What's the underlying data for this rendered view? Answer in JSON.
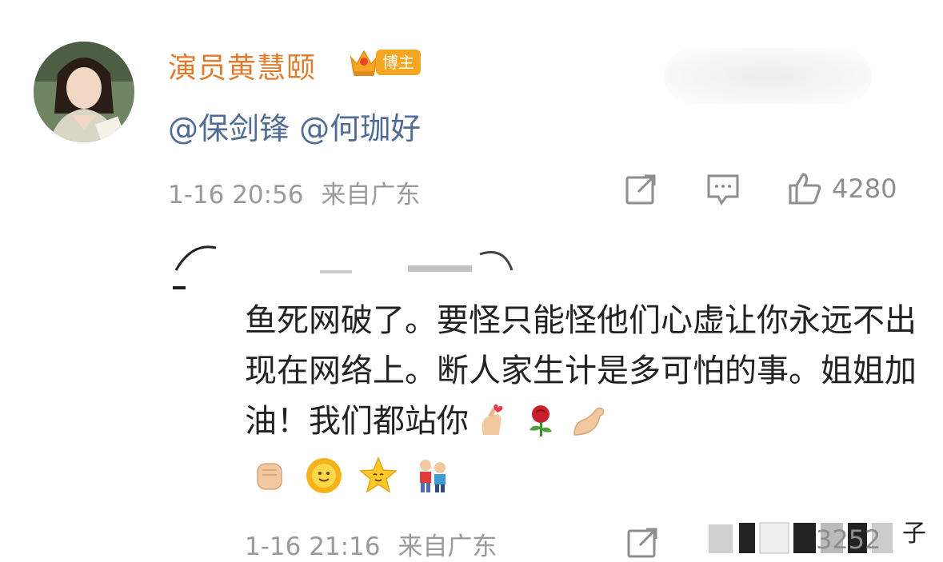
{
  "post": {
    "username": "演员黄慧颐",
    "badge": "博主",
    "comment": "@保剑锋 @何珈好",
    "timestamp": "1-16 20:56",
    "location": "来自广东",
    "likes": "4280"
  },
  "reply": {
    "text": "鱼死网破了。要怪只能怪他们心虚让你永远不出现在网络上。断人家生计是多可怕的事。姐姐加油！我们都站你",
    "timestamp": "1-16 21:16",
    "location": "来自广东",
    "likes": "3252",
    "trailing_text": "子"
  },
  "colors": {
    "username": "#e07a2e",
    "mention": "#4f6c97",
    "meta": "#9a9a9a"
  },
  "icons": [
    "share-icon",
    "comment-icon",
    "like-icon"
  ]
}
